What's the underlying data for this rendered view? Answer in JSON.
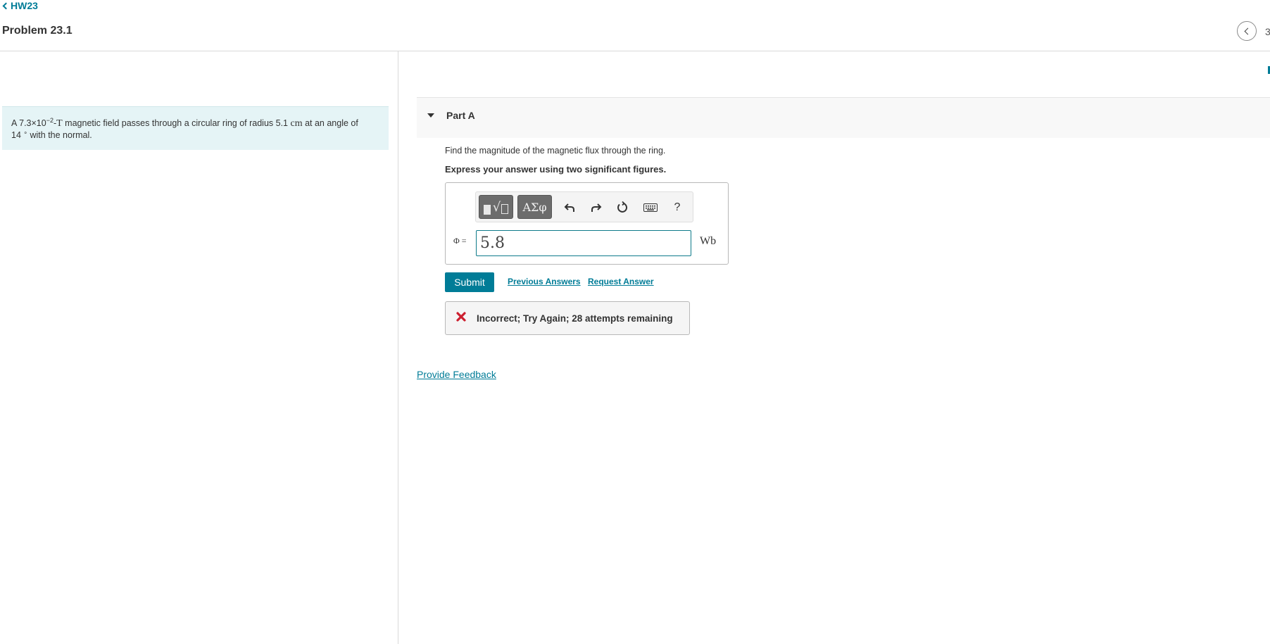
{
  "header": {
    "back_link": "HW23",
    "problem_title": "Problem 23.1",
    "nav_count": "3"
  },
  "problem": {
    "t1": "A 7.3×10",
    "exp": "−2",
    "t2": "-",
    "unit_T": "T",
    "t3": " magnetic field passes through a circular ring of radius 5.1 ",
    "unit_cm": "cm",
    "t4": " at an angle of",
    "t5": "14 ",
    "deg": "∘",
    "t6": " with the normal."
  },
  "part": {
    "label": "Part A",
    "prompt": "Find the magnitude of the magnetic flux through the ring.",
    "instruction": "Express your answer using two significant figures."
  },
  "toolbar": {
    "templates_icon": "templates-icon",
    "greek_label": "ΑΣφ",
    "undo_icon": "undo-icon",
    "redo_icon": "redo-icon",
    "reset_icon": "reset-icon",
    "keyboard_icon": "keyboard-icon",
    "help_label": "?"
  },
  "answer": {
    "variable_label": "Φ =",
    "value": "5.8",
    "unit": "Wb"
  },
  "actions": {
    "submit_label": "Submit",
    "previous_answers": "Previous Answers",
    "request_answer": "Request Answer"
  },
  "feedback": {
    "icon": "x-icon",
    "message": "Incorrect; Try Again; 28 attempts remaining"
  },
  "footer": {
    "provide_feedback": "Provide Feedback"
  },
  "colors": {
    "accent": "#007c97",
    "problem_bg": "#e5f4f6",
    "error": "#cc1f2f"
  }
}
